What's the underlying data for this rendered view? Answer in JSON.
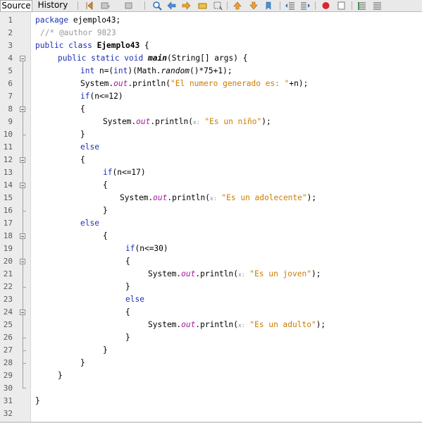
{
  "tabs": {
    "source": "Source",
    "history": "History"
  },
  "toolbar_icons": [
    "last-edit-icon",
    "back-icon",
    "forward-icon",
    "find-icon",
    "find-previous-icon",
    "find-next-icon",
    "toggle-highlight-icon",
    "toggle-rect-selection-icon",
    "previous-bookmark-icon",
    "next-bookmark-icon",
    "toggle-bookmark-icon",
    "shift-left-icon",
    "shift-right-icon",
    "start-macro-icon",
    "stop-macro-icon",
    "comment-icon",
    "uncomment-icon"
  ],
  "line_numbers": [
    "1",
    "2",
    "3",
    "4",
    "5",
    "6",
    "7",
    "8",
    "9",
    "10",
    "11",
    "12",
    "13",
    "14",
    "15",
    "16",
    "17",
    "18",
    "19",
    "20",
    "21",
    "22",
    "23",
    "24",
    "25",
    "26",
    "27",
    "28",
    "29",
    "30",
    "31",
    "32"
  ],
  "code": {
    "l1": {
      "kw": "package",
      "rest": " ejemplo43;"
    },
    "l2": {
      "comment": "//* @author 9823"
    },
    "l3": {
      "kw": "public class",
      "name": "Ejemplo43",
      "rest": " {"
    },
    "l4": {
      "kw": "public static void",
      "name": "main",
      "rest": "(String[] args) {"
    },
    "l5": {
      "kw": "int",
      "a": " n=(",
      "kw2": "int",
      "b": ")(Math.",
      "m": "random",
      "c": "()*75+1);"
    },
    "l6": {
      "a": "System.",
      "f": "out",
      "b": ".println(",
      "s": "\"El numero generado es: \"",
      "c": "+n);"
    },
    "l7": {
      "kw": "if",
      "rest": "(n<=12)"
    },
    "l8": {
      "text": "{"
    },
    "l9": {
      "a": "System.",
      "f": "out",
      "b": ".println(",
      "p": "x:",
      "s": "\"Es un niño\"",
      "c": ");"
    },
    "l10": {
      "text": "}"
    },
    "l11": {
      "kw": "else"
    },
    "l12": {
      "text": "{"
    },
    "l13": {
      "kw": "if",
      "rest": "(n<=17)"
    },
    "l14": {
      "text": "{"
    },
    "l15": {
      "a": "System.",
      "f": "out",
      "b": ".println(",
      "p": "x:",
      "s": "\"Es un adolecente\"",
      "c": ");"
    },
    "l16": {
      "text": "}"
    },
    "l17": {
      "kw": "else"
    },
    "l18": {
      "text": "{"
    },
    "l19": {
      "kw": "if",
      "rest": "(n<=30)"
    },
    "l20": {
      "text": "{"
    },
    "l21": {
      "a": "System.",
      "f": "out",
      "b": ".println(",
      "p": "x:",
      "s": "\"Es un joven\"",
      "c": ");"
    },
    "l22": {
      "text": "}"
    },
    "l23": {
      "kw": "else"
    },
    "l24": {
      "text": "{"
    },
    "l25": {
      "a": "System.",
      "f": "out",
      "b": ".println(",
      "p": "x:",
      "s": "\"Es un adulto\"",
      "c": ");"
    },
    "l26": {
      "text": "}"
    },
    "l27": {
      "text": "}"
    },
    "l28": {
      "text": "}"
    },
    "l29": {
      "text": "}"
    },
    "l31": {
      "text": "}"
    }
  },
  "colors": {
    "keyword": "#1e30b8",
    "string": "#ce7b00",
    "field": "#a31b9c",
    "comment": "#9a9a9a"
  }
}
